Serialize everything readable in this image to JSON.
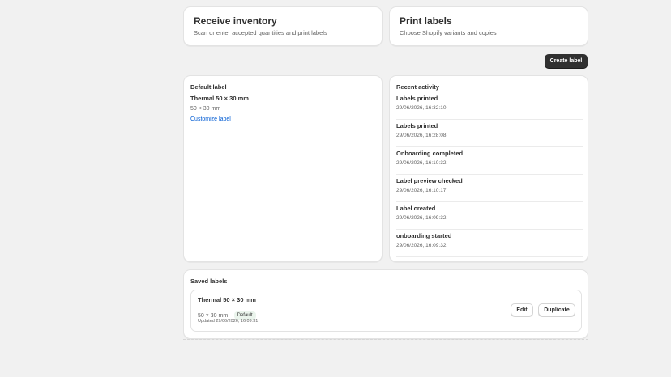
{
  "top_cards": [
    {
      "title": "Receive inventory",
      "subtitle": "Scan or enter accepted quantities and print labels"
    },
    {
      "title": "Print labels",
      "subtitle": "Choose Shopify variants and copies"
    }
  ],
  "actions": {
    "create_label": "Create label"
  },
  "default_label": {
    "heading": "Default label",
    "name": "Thermal 50 × 30 mm",
    "size": "50 × 30 mm",
    "customize_link": "Customize label"
  },
  "recent_activity": {
    "heading": "Recent activity",
    "items": [
      {
        "title": "Labels printed",
        "time": "29/06/2026, 16:32:10"
      },
      {
        "title": "Labels printed",
        "time": "29/06/2026, 16:28:08"
      },
      {
        "title": "Onboarding completed",
        "time": "29/06/2026, 16:10:32"
      },
      {
        "title": "Label preview checked",
        "time": "29/06/2026, 16:10:17"
      },
      {
        "title": "Label created",
        "time": "29/06/2026, 16:09:32"
      },
      {
        "title": "onboarding started",
        "time": "29/06/2026, 16:09:32"
      }
    ]
  },
  "saved_labels": {
    "heading": "Saved labels",
    "items": [
      {
        "name": "Thermal 50 × 30 mm",
        "size": "50 × 30 mm",
        "badge": "Default",
        "updated": "Updated 29/06/2026, 16:09:31",
        "edit_label": "Edit",
        "duplicate_label": "Duplicate"
      }
    ]
  },
  "colors": {
    "background": "#f1f1f1",
    "card": "#ffffff",
    "primary_button": "#303030",
    "link": "#005bd3",
    "badge": "#eaf4ec"
  }
}
